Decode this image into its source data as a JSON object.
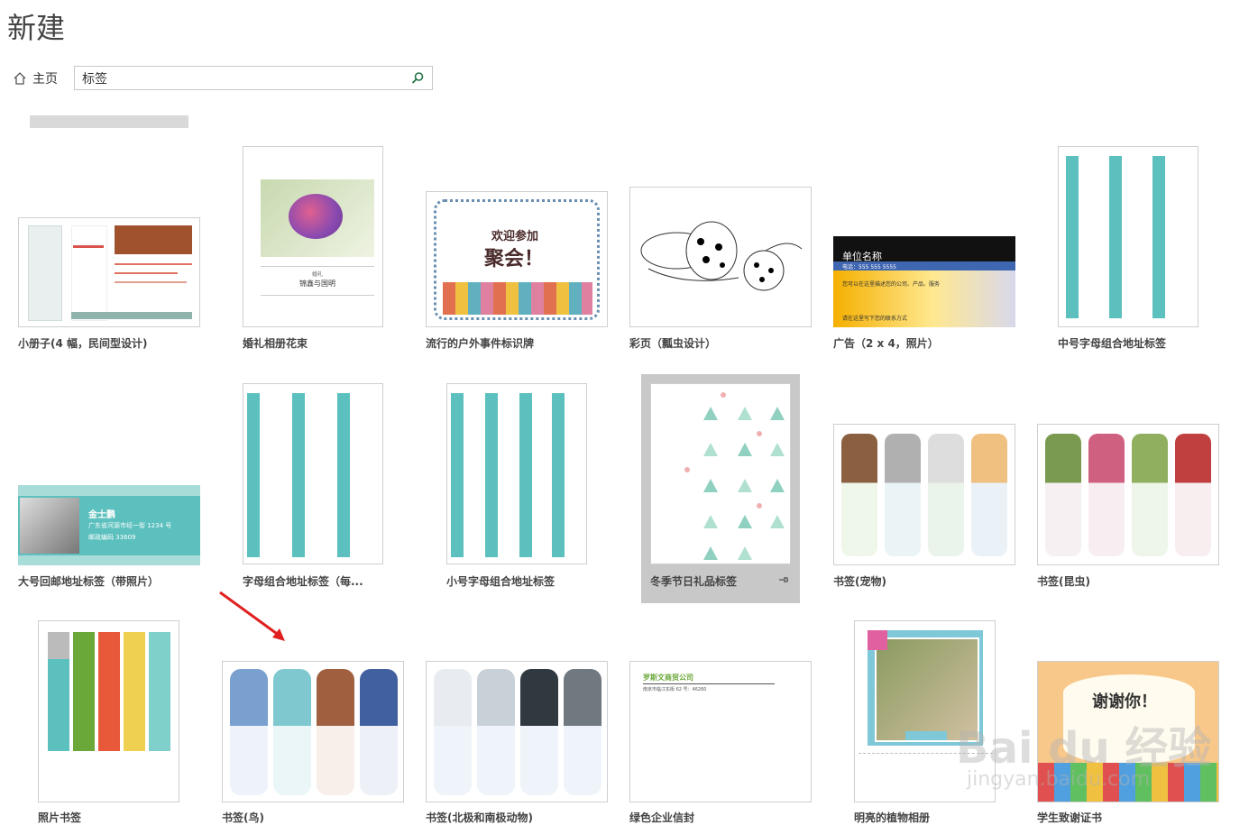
{
  "header": {
    "title": "新建"
  },
  "nav": {
    "home_label": "主页"
  },
  "search": {
    "value": "标签"
  },
  "colors": {
    "teal": "#5bc0be",
    "accent_green": "#217346",
    "arrow_red": "#e02020"
  },
  "templates": [
    {
      "label": "小册子(4 幅，民间型设计)"
    },
    {
      "label": "婚礼相册花束"
    },
    {
      "label": "流行的户外事件标识牌"
    },
    {
      "label": "彩页（瓢虫设计）"
    },
    {
      "label": "广告（2 x 4，照片）"
    },
    {
      "label": "中号字母组合地址标签"
    },
    {
      "label": "大号回邮地址标签（带照片）"
    },
    {
      "label": "字母组合地址标签（每..."
    },
    {
      "label": "小号字母组合地址标签"
    },
    {
      "label": "冬季节日礼品标签"
    },
    {
      "label": "书签(宠物)"
    },
    {
      "label": "书签(昆虫)"
    },
    {
      "label": "照片书签"
    },
    {
      "label": "书签(鸟)"
    },
    {
      "label": "书签(北极和南极动物)"
    },
    {
      "label": "绿色企业信封"
    },
    {
      "label": "明亮的植物相册"
    },
    {
      "label": "学生致谢证书"
    }
  ],
  "thumb_text": {
    "party_line1": "欢迎参加",
    "party_line2": "聚会！",
    "ad_company": "单位名称",
    "ad_phone": "电话：555 555 5555",
    "ad_body": "您可以在这里描述您的公司、产品、服务",
    "ad_footer": "请在这里写下您的联系方式",
    "wedding_small": "婚礼",
    "wedding_names": "锦鑫与国明",
    "return_name": "金士鹏",
    "return_addr": "广东省河源市经一街 1234 号",
    "return_zip": "邮政编码 33609",
    "envelope_company": "罗斯文商贸公司",
    "envelope_addr": "南京市临江东街 62 号：46260",
    "thanks": "谢谢你！"
  },
  "watermark": {
    "main": "Bai du 经验",
    "sub": "jingyan.baidu.com"
  }
}
